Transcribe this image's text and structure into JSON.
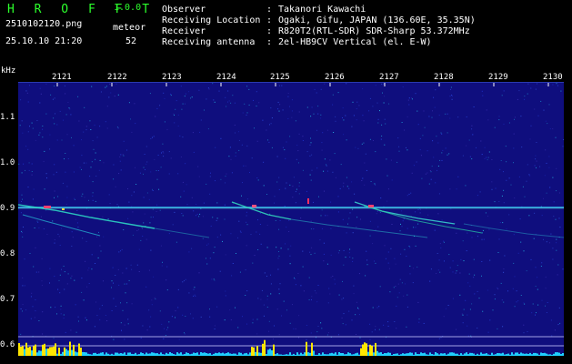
{
  "header": {
    "logo": "H R O F F T",
    "version": "1.0.0",
    "filename": "2510102120.png",
    "meteor_label": "meteor",
    "date": "25.10.10 21:20",
    "meteor_count": "52",
    "info": [
      {
        "key": "Observer",
        "value": "Takanori Kawachi"
      },
      {
        "key": "Receiving Location",
        "value": "Ogaki, Gifu, JAPAN (136.60E, 35.35N)"
      },
      {
        "key": "Receiver",
        "value": "R820T2(RTL-SDR) SDR-Sharp 53.372MHz"
      },
      {
        "key": "Receiving antenna",
        "value": "2el-HB9CV Vertical (el. E-W)"
      }
    ]
  },
  "axis": {
    "unit": "kHz",
    "time_labels": [
      "2121",
      "2122",
      "2123",
      "2124",
      "2125",
      "2126",
      "2127",
      "2128",
      "2129",
      "2130"
    ],
    "freq_labels": [
      "1.1",
      "1.0",
      "0.9",
      "0.8",
      "0.7",
      "0.6"
    ]
  },
  "colors": {
    "background": "#0f0e7e",
    "carrier": "#3fd7ff",
    "logo": "#2cff2c",
    "activity": "#ffe600"
  }
}
